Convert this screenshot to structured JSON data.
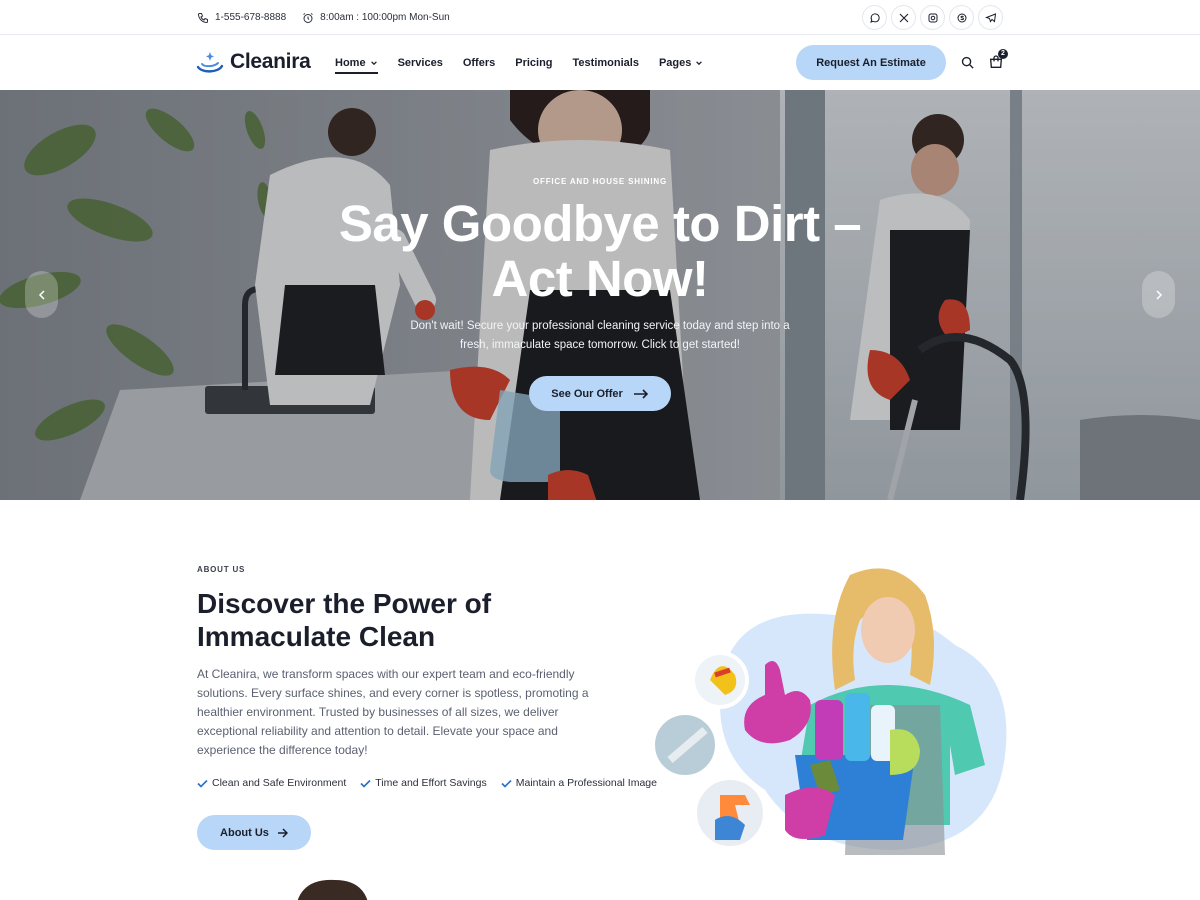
{
  "topbar": {
    "phone": "1-555-678-8888",
    "hours": "8:00am : 100:00pm Mon-Sun",
    "socials": [
      "whatsapp-icon",
      "x-icon",
      "instagram-icon",
      "skype-icon",
      "telegram-icon"
    ]
  },
  "header": {
    "brand": "Cleanira",
    "nav": [
      {
        "label": "Home",
        "has_dropdown": true,
        "active": true
      },
      {
        "label": "Services",
        "has_dropdown": false
      },
      {
        "label": "Offers",
        "has_dropdown": false
      },
      {
        "label": "Pricing",
        "has_dropdown": false
      },
      {
        "label": "Testimonials",
        "has_dropdown": false
      },
      {
        "label": "Pages",
        "has_dropdown": true
      }
    ],
    "cta": "Request An Estimate",
    "cart_count": "2"
  },
  "hero": {
    "kicker": "OFFICE AND HOUSE SHINING",
    "title": "Say Goodbye to Dirt – Act Now!",
    "description": "Don't wait! Secure your professional cleaning service today and step into a fresh, immaculate space tomorrow. Click to get started!",
    "cta": "See Our Offer"
  },
  "about": {
    "kicker": "ABOUT US",
    "title": "Discover the Power of Immaculate Clean",
    "description": "At Cleanira, we transform spaces with our expert team and eco-friendly solutions. Every surface shines, and every corner is spotless, promoting a healthier environment. Trusted by businesses of all sizes, we deliver exceptional reliability and attention to detail. Elevate your space and experience the difference today!",
    "features": [
      "Clean and Safe Environment",
      "Time and Effort Savings",
      "Maintain a Professional Image"
    ],
    "cta": "About Us"
  },
  "colors": {
    "accent": "#b8d6f7",
    "text": "#1a1f2b",
    "muted": "#5b6170"
  }
}
